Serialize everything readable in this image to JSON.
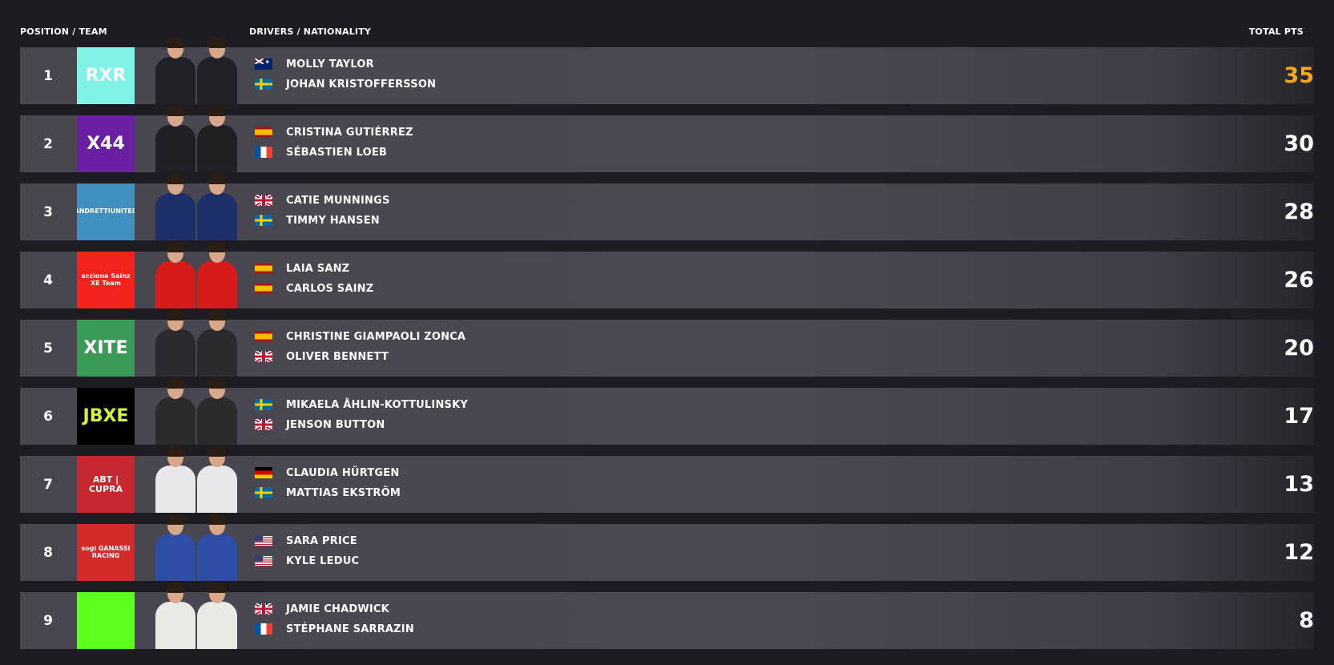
{
  "header": {
    "position_team": "POSITION / TEAM",
    "drivers_nationality": "DRIVERS / NATIONALITY",
    "total_pts": "TOTAL PTS"
  },
  "colors": {
    "background": "#1d1c23",
    "row": "#48464f",
    "leader_points": "#f6a81d",
    "text": "#ffffff"
  },
  "standings": [
    {
      "position": "1",
      "team_logo_text": "RXR",
      "team_logo_color": "#7ef3e6",
      "team_logo_text_color": "#ffffff",
      "suit_color": "#1e2126",
      "driver1": {
        "name": "MOLLY TAYLOR",
        "flag": "au-flag-icon"
      },
      "driver2": {
        "name": "JOHAN KRISTOFFERSSON",
        "flag": "se-flag-icon"
      },
      "points": "35",
      "points_color": "#f6a81d"
    },
    {
      "position": "2",
      "team_logo_text": "X44",
      "team_logo_color": "#6a1fa3",
      "team_logo_text_color": "#ffffff",
      "suit_color": "#1f1f24",
      "driver1": {
        "name": "CRISTINA GUTIÉRREZ",
        "flag": "es-flag-icon"
      },
      "driver2": {
        "name": "SÉBASTIEN LOEB",
        "flag": "fr-flag-icon"
      },
      "points": "30",
      "points_color": "#ffffff"
    },
    {
      "position": "3",
      "team_logo_text": "ANDRETTIUNITED",
      "team_logo_color": "#3f8fbf",
      "team_logo_text_color": "#ffffff",
      "suit_color": "#1d2f6b",
      "driver1": {
        "name": "CATIE MUNNINGS",
        "flag": "gb-flag-icon"
      },
      "driver2": {
        "name": "TIMMY HANSEN",
        "flag": "se-flag-icon"
      },
      "points": "28",
      "points_color": "#ffffff"
    },
    {
      "position": "4",
      "team_logo_text": "acciona Sainz XE Team",
      "team_logo_color": "#f2231a",
      "team_logo_text_color": "#ffffff",
      "suit_color": "#d61b1b",
      "driver1": {
        "name": "LAIA SANZ",
        "flag": "es-flag-icon"
      },
      "driver2": {
        "name": "CARLOS SAINZ",
        "flag": "es-flag-icon"
      },
      "points": "26",
      "points_color": "#ffffff"
    },
    {
      "position": "5",
      "team_logo_text": "XITE",
      "team_logo_color": "#3a9a56",
      "team_logo_text_color": "#ffffff",
      "suit_color": "#2a2a2e",
      "driver1": {
        "name": "CHRISTINE GIAMPAOLI ZONCA",
        "flag": "es-flag-icon"
      },
      "driver2": {
        "name": "OLIVER BENNETT",
        "flag": "gb-flag-icon"
      },
      "points": "20",
      "points_color": "#ffffff"
    },
    {
      "position": "6",
      "team_logo_text": "JBXE",
      "team_logo_color": "#000000",
      "team_logo_text_color": "#d6f23a",
      "suit_color": "#2b2b2b",
      "driver1": {
        "name": "MIKAELA ÅHLIN-KOTTULINSKY",
        "flag": "se-flag-icon"
      },
      "driver2": {
        "name": "JENSON BUTTON",
        "flag": "gb-flag-icon"
      },
      "points": "17",
      "points_color": "#ffffff"
    },
    {
      "position": "7",
      "team_logo_text": "ABT | CUPRA",
      "team_logo_color": "#c7282e",
      "team_logo_text_color": "#ffffff",
      "suit_color": "#e8e8ea",
      "driver1": {
        "name": "CLAUDIA HÜRTGEN",
        "flag": "de-flag-icon"
      },
      "driver2": {
        "name": "MATTIAS EKSTRÖM",
        "flag": "se-flag-icon"
      },
      "points": "13",
      "points_color": "#ffffff"
    },
    {
      "position": "8",
      "team_logo_text": "sogi GANASSI RACING",
      "team_logo_color": "#d42a2a",
      "team_logo_text_color": "#ffffff",
      "suit_color": "#2c4ea6",
      "driver1": {
        "name": "SARA PRICE",
        "flag": "us-flag-icon"
      },
      "driver2": {
        "name": "KYLE LEDUC",
        "flag": "us-flag-icon"
      },
      "points": "12",
      "points_color": "#ffffff"
    },
    {
      "position": "9",
      "team_logo_text": "",
      "team_logo_color": "#5cff1c",
      "team_logo_text_color": "#000000",
      "suit_color": "#e6ebe4",
      "driver1": {
        "name": "JAMIE CHADWICK",
        "flag": "gb-flag-icon"
      },
      "driver2": {
        "name": "STÉPHANE SARRAZIN",
        "flag": "fr-flag-icon"
      },
      "points": "8",
      "points_color": "#ffffff"
    }
  ]
}
